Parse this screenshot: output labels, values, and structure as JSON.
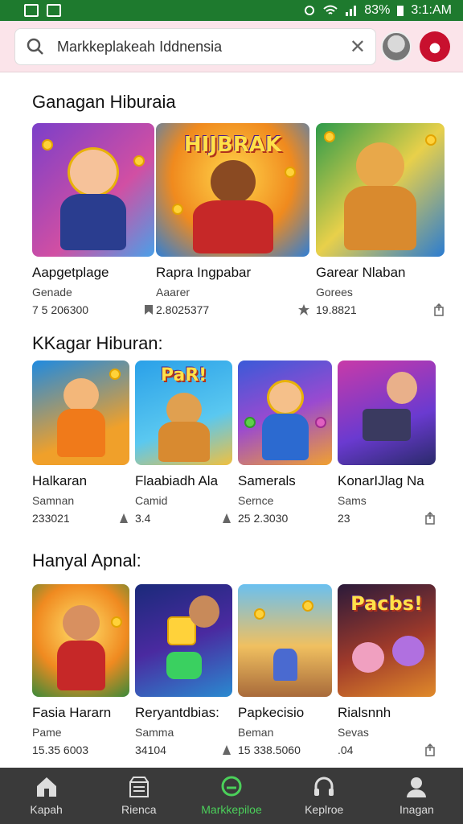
{
  "status": {
    "battery": "83%",
    "time": "3:1:AM"
  },
  "search": {
    "value": "Markkeplakeah Iddnensia"
  },
  "sections": [
    {
      "title": "Ganagan Hiburaia",
      "cards": [
        {
          "name": "Aapgetplage",
          "category": "Genade",
          "meta": "7 5 206300",
          "banner": ""
        },
        {
          "name": "Rapra Ingpabar",
          "category": "Aaarer",
          "meta": "2.8025377",
          "banner": "HIJBRAK"
        },
        {
          "name": "Garear Nlaban",
          "category": "Gorees",
          "meta": "19.8821",
          "banner": ""
        }
      ]
    },
    {
      "title": "KKagar Hiburan:",
      "cards": [
        {
          "name": "Halkaran",
          "category": "Samnan",
          "meta": "233021",
          "banner": ""
        },
        {
          "name": "Flaabiadh Ala",
          "category": "Camid",
          "meta": "3.4",
          "banner": "PaR!"
        },
        {
          "name": "Samerals",
          "category": "Sernce",
          "meta": "25 2.3030",
          "banner": ""
        },
        {
          "name": "KonarIJlag Na",
          "category": "Sams",
          "meta": "23",
          "banner": ""
        }
      ]
    },
    {
      "title": "Hanyal Apnal:",
      "cards": [
        {
          "name": "Fasia Hararn",
          "category": "Pame",
          "meta": "15.35 6003",
          "banner": ""
        },
        {
          "name": "Reryantdbias:",
          "category": "Samma",
          "meta": "34104",
          "banner": ""
        },
        {
          "name": "Papkecisio",
          "category": "Beman",
          "meta": "15 338.5060",
          "banner": ""
        },
        {
          "name": "Rialsnnh",
          "category": "Sevas",
          "meta": ".04",
          "banner": "Pacbs!"
        }
      ]
    }
  ],
  "nav": [
    {
      "label": "Kapah",
      "icon": "home-icon"
    },
    {
      "label": "Rienca",
      "icon": "store-icon"
    },
    {
      "label": "Markkepiloe",
      "icon": "marketplace-icon"
    },
    {
      "label": "Keplroe",
      "icon": "headset-icon"
    },
    {
      "label": "Inagan",
      "icon": "profile-icon"
    }
  ],
  "colors": {
    "statusbar": "#1e7a2e",
    "header": "#fbe4ea",
    "nav_bg": "#3a3a3a",
    "nav_active": "#4bd05a"
  }
}
